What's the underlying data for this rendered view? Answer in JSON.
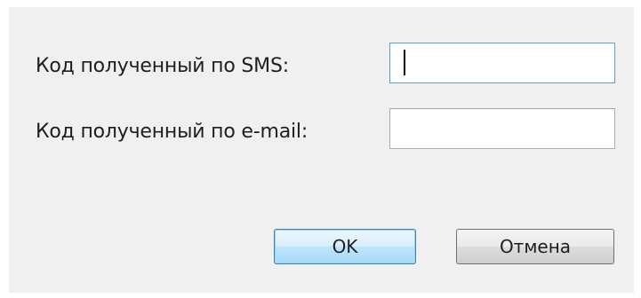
{
  "form": {
    "sms_label": "Код полученный по SMS:",
    "sms_value": "",
    "email_label": "Код полученный по e-mail:",
    "email_value": ""
  },
  "buttons": {
    "ok_label": "OK",
    "cancel_label": "Отмена"
  },
  "colors": {
    "dialog_background": "#f0f0f0",
    "focus_border": "#5a9fd6",
    "default_button_border": "#3c7fb1"
  }
}
